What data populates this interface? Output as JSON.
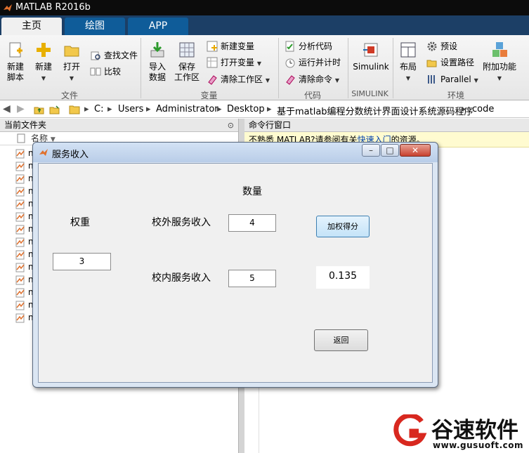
{
  "window": {
    "title": "MATLAB R2016b"
  },
  "tabs": [
    {
      "label": "主页",
      "active": true
    },
    {
      "label": "绘图",
      "active": false
    },
    {
      "label": "APP",
      "active": false
    }
  ],
  "ribbon": {
    "file": {
      "group_label": "文件",
      "new_script": "新建\n脚本",
      "new": "新建",
      "open": "打开",
      "find_files": "查找文件",
      "compare": "比较"
    },
    "variable": {
      "group_label": "变量",
      "import_data": "导入\n数据",
      "save_workspace": "保存\n工作区",
      "new_variable": "新建变量",
      "open_variable": "打开变量",
      "clear_workspace": "清除工作区"
    },
    "code": {
      "group_label": "代码",
      "analyze_code": "分析代码",
      "run_and_time": "运行并计时",
      "clear_commands": "清除命令"
    },
    "simulink": {
      "group_label": "SIMULINK",
      "simulink": "Simulink"
    },
    "environment": {
      "group_label": "环境",
      "layout": "布局",
      "preferences": "预设",
      "set_path": "设置路径",
      "parallel": "Parallel",
      "addons": "附加功能"
    }
  },
  "address": {
    "crumbs": [
      "C:",
      "Users",
      "Administrator",
      "Desktop",
      "基于matlab编程分数统计界面设计系统源码程序",
      "code"
    ]
  },
  "left_panel": {
    "title": "当前文件夹",
    "column_header": "名称",
    "file_prefix": "n"
  },
  "right_panel": {
    "title": "命令行窗口",
    "notice_text": "不熟悉 MATLAB?请参阅有关",
    "notice_link": "快速入门",
    "notice_tail": "的资源。"
  },
  "dialog": {
    "title": "服务收入",
    "quantity_label": "数量",
    "weight_label": "权重",
    "off_campus_label": "校外服务收入",
    "on_campus_label": "校内服务收入",
    "off_campus_value": "4",
    "on_campus_value": "5",
    "weight_value": "3",
    "weighted_button": "加权得分",
    "result_value": "0.135",
    "back_button": "返回"
  },
  "watermark": {
    "text": "谷速软件",
    "url": "www.gusuoft.com"
  },
  "colors": {
    "titlebar": "#0c0c0c",
    "tabstrip": "#1c3f66",
    "tab_inactive": "#0f5c99",
    "dialog_frame": "#dbe6f3",
    "watermark_red": "#d8281f"
  }
}
